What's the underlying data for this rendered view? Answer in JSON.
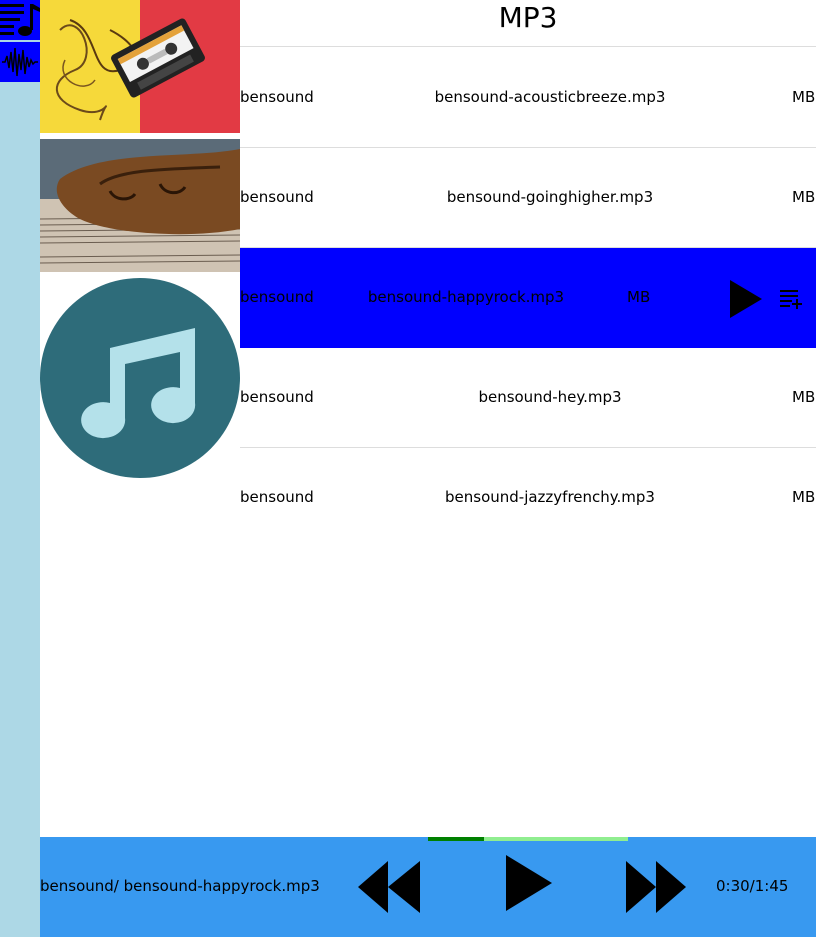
{
  "header": {
    "title": "MP3"
  },
  "nav": {
    "items": [
      {
        "icon": "playlist-music-icon"
      },
      {
        "icon": "waveform-icon"
      }
    ]
  },
  "artwork": [
    {
      "icon": "cassette-tape-image"
    },
    {
      "icon": "violin-sheet-music-image"
    },
    {
      "icon": "music-note-icon"
    }
  ],
  "tracks": [
    {
      "artist": "bensound",
      "filename": "bensound-acousticbreeze.mp3",
      "size": "MB"
    },
    {
      "artist": "bensound",
      "filename": "bensound-goinghigher.mp3",
      "size": "MB"
    },
    {
      "artist": "bensound",
      "filename": "bensound-happyrock.mp3",
      "size": "MB",
      "selected": true
    },
    {
      "artist": "bensound",
      "filename": "bensound-hey.mp3",
      "size": "MB"
    },
    {
      "artist": "bensound",
      "filename": "bensound-jazzyfrenchy.mp3",
      "size": "MB"
    }
  ],
  "player": {
    "now_playing": "bensound/ bensound-happyrock.mp3",
    "time": "0:30/1:45",
    "progress": 0.28,
    "controls": [
      "rewind-icon",
      "play-icon",
      "fast-forward-icon"
    ]
  },
  "colors": {
    "nav_rail": "#add8e6",
    "nav_button": "#0000ff",
    "selected_row": "#0000ff",
    "player_bar": "#3899f0",
    "progress_fill": "#008000",
    "progress_track": "#90ee90",
    "music_circle": "#2e6c7a",
    "music_note": "#b4e1ea"
  }
}
